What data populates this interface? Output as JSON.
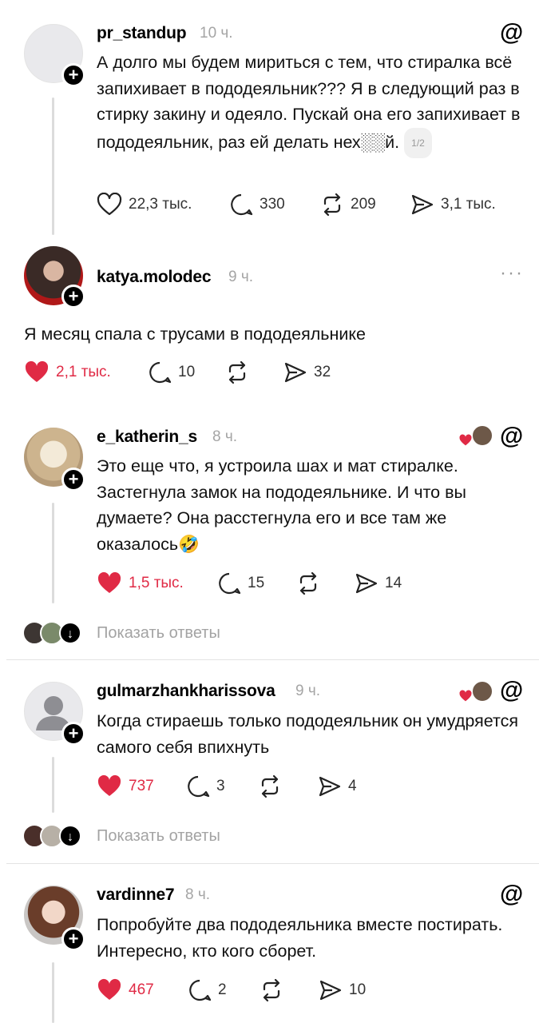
{
  "posts": [
    {
      "username": "pr_standup",
      "time": "10 ч.",
      "text": "А долго мы будем мириться с тем, что стиралка всё запихивает в пододеяльник??? Я в следующий раз в стирку закину и одеяло. Пускай она его запихивает в пододеяльник, раз ей делать нех░░й.",
      "pager": "1/2",
      "likes": "22,3 тыс.",
      "comments": "330",
      "reposts": "209",
      "shares": "3,1 тыс.",
      "liked": false,
      "avatar_icon": "blank-avatar-icon",
      "corner_icon": "threads-icon"
    },
    {
      "username": "katya.molodec",
      "time": "9 ч.",
      "text": "Я месяц спала с трусами в пододеяльнике",
      "likes": "2,1 тыс.",
      "comments": "10",
      "reposts": "",
      "shares": "32",
      "liked": true,
      "avatar_icon": "user-photo-icon",
      "corner_icon": "more-icon"
    },
    {
      "username": "e_katherin_s",
      "time": "8 ч.",
      "text": "Это еще что, я устроила шах и мат стиралке. Застегнула замок на пододеяльнике. И что вы думаете? Она расстегнула его и все там же оказалось🤣",
      "likes": "1,5 тыс.",
      "comments": "15",
      "reposts": "",
      "shares": "14",
      "liked": true,
      "avatar_icon": "user-photo-icon",
      "corner_icon": "threads-icon",
      "show_replies": "Показать ответы"
    },
    {
      "username": "gulmarzhankharissova",
      "time": "9 ч.",
      "text": "Когда стираешь только пододеяльник он умудряется самого себя впихнуть",
      "likes": "737",
      "comments": "3",
      "reposts": "",
      "shares": "4",
      "liked": true,
      "avatar_icon": "default-person-icon",
      "corner_icon": "threads-icon",
      "show_replies": "Показать ответы"
    },
    {
      "username": "vardinne7",
      "time": "8 ч.",
      "text": "Попробуйте два пододеяльника вместе постирать. Интересно, кто кого сборет.",
      "likes": "467",
      "comments": "2",
      "reposts": "",
      "shares": "10",
      "liked": true,
      "avatar_icon": "user-photo-icon",
      "corner_icon": "threads-icon"
    }
  ],
  "colors": {
    "like_red": "#e02a45",
    "muted": "#a3a3a3"
  }
}
